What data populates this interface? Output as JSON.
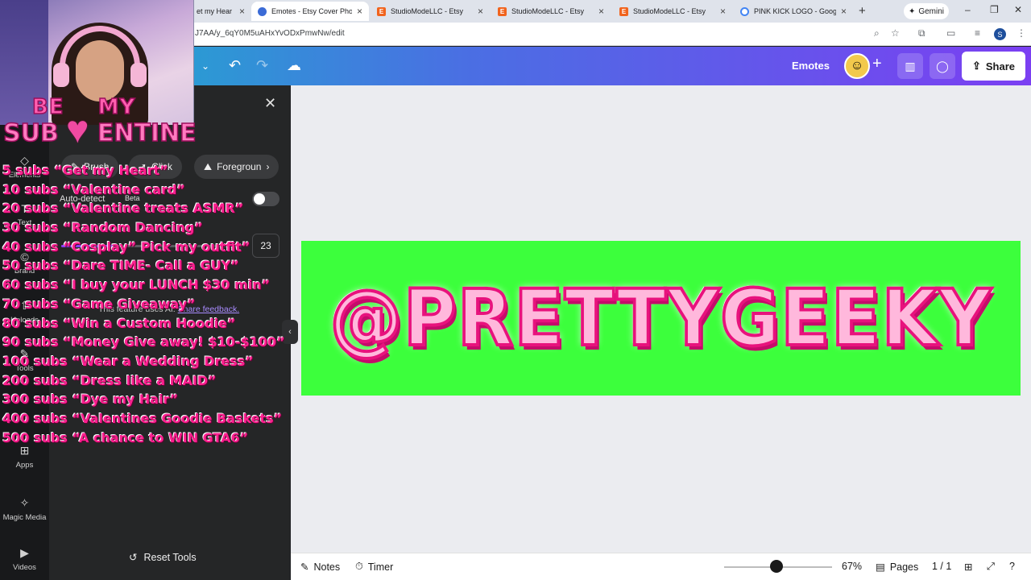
{
  "browser": {
    "tabs": [
      {
        "label": "et my Hear",
        "favicon": "none"
      },
      {
        "label": "Emotes - Etsy Cover Photo",
        "favicon": "canva-icon",
        "active": true
      },
      {
        "label": "StudioModeLLC - Etsy",
        "favicon": "etsy-icon"
      },
      {
        "label": "StudioModeLLC - Etsy",
        "favicon": "etsy-icon"
      },
      {
        "label": "StudioModeLLC - Etsy",
        "favicon": "etsy-icon"
      },
      {
        "label": "PINK KICK LOGO - Google Se",
        "favicon": "google-icon"
      }
    ],
    "new_tab": "+",
    "gemini_label": "Gemini",
    "url": "J7AA/y_6qY0M5uAHxYvODxPmwNw/edit",
    "profile_initial": "S"
  },
  "header": {
    "title": "Emotes",
    "share_label": "Share",
    "plus": "+"
  },
  "sidebar": {
    "rail": [
      {
        "label": "Elements",
        "icon": "shapes-icon"
      },
      {
        "label": "Text",
        "icon": "text-icon"
      },
      {
        "label": "Brand",
        "icon": "brand-icon"
      },
      {
        "label": "Uploads",
        "icon": "upload-icon"
      },
      {
        "label": "Tools",
        "icon": "tools-icon"
      },
      {
        "label": "Apps",
        "icon": "apps-icon"
      },
      {
        "label": "Magic Media",
        "icon": "magic-media-icon"
      },
      {
        "label": "Videos",
        "icon": "videos-icon"
      }
    ],
    "panel": {
      "tools": [
        "Brush",
        "Click",
        "Foregroun"
      ],
      "auto_detect_label": "Auto-detect",
      "beta_label": "Beta",
      "size_value": "23",
      "notice_text": "This feature uses AI.",
      "feedback_link": "Share feedback.",
      "reset_label": "Reset Tools"
    }
  },
  "canvas": {
    "design_text": "@PRETTYGEEKY"
  },
  "bottom_bar": {
    "notes_label": "Notes",
    "timer_label": "Timer",
    "zoom": "67%",
    "pages_label": "Pages",
    "page_count": "1 / 1"
  },
  "overlay": {
    "logo_line1_left": "BE",
    "logo_line1_right": "MY",
    "logo_line2_left": "SUB",
    "logo_line2_right": "ENTINE",
    "goals": [
      "5 subs “Get my Heart”",
      "10 subs “Valentine card”",
      "20 subs “Valentine treats ASMR”",
      "30 subs “Random Dancing”",
      "40 subs “Cosplay” Pick my outfit”",
      "50 subs “Dare TIME- Call a GUY”",
      "60 subs “I buy your LUNCH $30 min”",
      "70 subs “Game Giveaway”",
      "80 subs “Win a Custom Hoodie”",
      "90 subs “Money Give away! $10-$100”",
      "100 subs “Wear a Wedding Dress”",
      "200 subs “Dress like a MAID”",
      "300 subs “Dye my Hair”",
      "400 subs “Valentines Goodie Baskets”",
      "500 subs “A chance to WIN GTA6”"
    ]
  },
  "colors": {
    "canvas_bg": "#3cff3c",
    "accent": "#8b3dff",
    "goal_text": "#ff1f8f"
  }
}
